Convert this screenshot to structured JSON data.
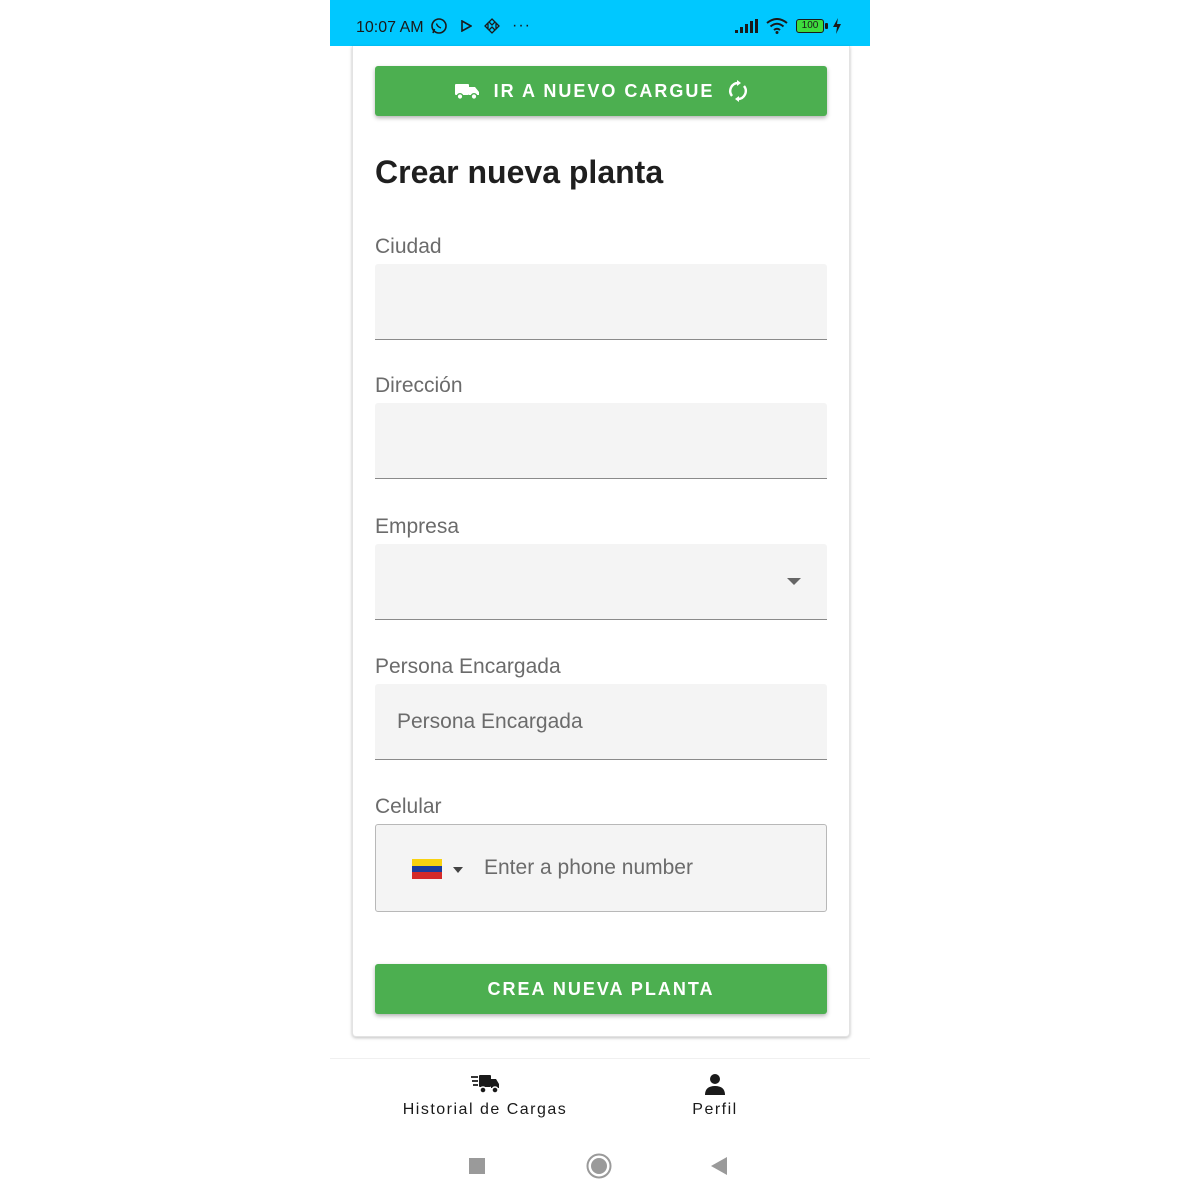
{
  "status_bar": {
    "time": "10:07 AM",
    "battery": "100",
    "background": "#00c8ff"
  },
  "form": {
    "top_button_label": "IR A NUEVO CARGUE",
    "title": "Crear nueva planta",
    "fields": [
      {
        "label": "Ciudad",
        "value": "",
        "placeholder": ""
      },
      {
        "label": "Dirección",
        "value": "",
        "placeholder": ""
      },
      {
        "label": "Empresa",
        "value": "",
        "type": "dropdown"
      },
      {
        "label": "Persona Encargada",
        "value": "",
        "placeholder": "Persona Encargada"
      },
      {
        "label": "Celular",
        "country_flag": "venezuela-flag-icon",
        "placeholder": "Enter a phone number"
      }
    ],
    "submit_label": "CREA NUEVA PLANTA",
    "accent_color": "#4caf50"
  },
  "bottom_nav": {
    "items": [
      {
        "label": "Historial de Cargas",
        "icon": "truck-icon"
      },
      {
        "label": "Perfil",
        "icon": "person-icon"
      }
    ]
  },
  "system_nav": {
    "icons": [
      "square-recents-icon",
      "circle-home-icon",
      "triangle-back-icon"
    ]
  }
}
